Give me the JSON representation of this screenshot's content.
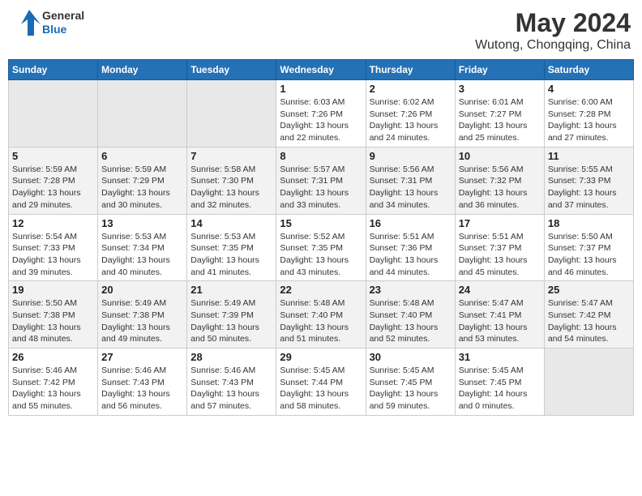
{
  "header": {
    "logo_line1": "General",
    "logo_line2": "Blue",
    "month_title": "May 2024",
    "location": "Wutong, Chongqing, China"
  },
  "weekdays": [
    "Sunday",
    "Monday",
    "Tuesday",
    "Wednesday",
    "Thursday",
    "Friday",
    "Saturday"
  ],
  "weeks": [
    [
      {
        "day": "",
        "info": ""
      },
      {
        "day": "",
        "info": ""
      },
      {
        "day": "",
        "info": ""
      },
      {
        "day": "1",
        "info": "Sunrise: 6:03 AM\nSunset: 7:26 PM\nDaylight: 13 hours\nand 22 minutes."
      },
      {
        "day": "2",
        "info": "Sunrise: 6:02 AM\nSunset: 7:26 PM\nDaylight: 13 hours\nand 24 minutes."
      },
      {
        "day": "3",
        "info": "Sunrise: 6:01 AM\nSunset: 7:27 PM\nDaylight: 13 hours\nand 25 minutes."
      },
      {
        "day": "4",
        "info": "Sunrise: 6:00 AM\nSunset: 7:28 PM\nDaylight: 13 hours\nand 27 minutes."
      }
    ],
    [
      {
        "day": "5",
        "info": "Sunrise: 5:59 AM\nSunset: 7:28 PM\nDaylight: 13 hours\nand 29 minutes."
      },
      {
        "day": "6",
        "info": "Sunrise: 5:59 AM\nSunset: 7:29 PM\nDaylight: 13 hours\nand 30 minutes."
      },
      {
        "day": "7",
        "info": "Sunrise: 5:58 AM\nSunset: 7:30 PM\nDaylight: 13 hours\nand 32 minutes."
      },
      {
        "day": "8",
        "info": "Sunrise: 5:57 AM\nSunset: 7:31 PM\nDaylight: 13 hours\nand 33 minutes."
      },
      {
        "day": "9",
        "info": "Sunrise: 5:56 AM\nSunset: 7:31 PM\nDaylight: 13 hours\nand 34 minutes."
      },
      {
        "day": "10",
        "info": "Sunrise: 5:56 AM\nSunset: 7:32 PM\nDaylight: 13 hours\nand 36 minutes."
      },
      {
        "day": "11",
        "info": "Sunrise: 5:55 AM\nSunset: 7:33 PM\nDaylight: 13 hours\nand 37 minutes."
      }
    ],
    [
      {
        "day": "12",
        "info": "Sunrise: 5:54 AM\nSunset: 7:33 PM\nDaylight: 13 hours\nand 39 minutes."
      },
      {
        "day": "13",
        "info": "Sunrise: 5:53 AM\nSunset: 7:34 PM\nDaylight: 13 hours\nand 40 minutes."
      },
      {
        "day": "14",
        "info": "Sunrise: 5:53 AM\nSunset: 7:35 PM\nDaylight: 13 hours\nand 41 minutes."
      },
      {
        "day": "15",
        "info": "Sunrise: 5:52 AM\nSunset: 7:35 PM\nDaylight: 13 hours\nand 43 minutes."
      },
      {
        "day": "16",
        "info": "Sunrise: 5:51 AM\nSunset: 7:36 PM\nDaylight: 13 hours\nand 44 minutes."
      },
      {
        "day": "17",
        "info": "Sunrise: 5:51 AM\nSunset: 7:37 PM\nDaylight: 13 hours\nand 45 minutes."
      },
      {
        "day": "18",
        "info": "Sunrise: 5:50 AM\nSunset: 7:37 PM\nDaylight: 13 hours\nand 46 minutes."
      }
    ],
    [
      {
        "day": "19",
        "info": "Sunrise: 5:50 AM\nSunset: 7:38 PM\nDaylight: 13 hours\nand 48 minutes."
      },
      {
        "day": "20",
        "info": "Sunrise: 5:49 AM\nSunset: 7:38 PM\nDaylight: 13 hours\nand 49 minutes."
      },
      {
        "day": "21",
        "info": "Sunrise: 5:49 AM\nSunset: 7:39 PM\nDaylight: 13 hours\nand 50 minutes."
      },
      {
        "day": "22",
        "info": "Sunrise: 5:48 AM\nSunset: 7:40 PM\nDaylight: 13 hours\nand 51 minutes."
      },
      {
        "day": "23",
        "info": "Sunrise: 5:48 AM\nSunset: 7:40 PM\nDaylight: 13 hours\nand 52 minutes."
      },
      {
        "day": "24",
        "info": "Sunrise: 5:47 AM\nSunset: 7:41 PM\nDaylight: 13 hours\nand 53 minutes."
      },
      {
        "day": "25",
        "info": "Sunrise: 5:47 AM\nSunset: 7:42 PM\nDaylight: 13 hours\nand 54 minutes."
      }
    ],
    [
      {
        "day": "26",
        "info": "Sunrise: 5:46 AM\nSunset: 7:42 PM\nDaylight: 13 hours\nand 55 minutes."
      },
      {
        "day": "27",
        "info": "Sunrise: 5:46 AM\nSunset: 7:43 PM\nDaylight: 13 hours\nand 56 minutes."
      },
      {
        "day": "28",
        "info": "Sunrise: 5:46 AM\nSunset: 7:43 PM\nDaylight: 13 hours\nand 57 minutes."
      },
      {
        "day": "29",
        "info": "Sunrise: 5:45 AM\nSunset: 7:44 PM\nDaylight: 13 hours\nand 58 minutes."
      },
      {
        "day": "30",
        "info": "Sunrise: 5:45 AM\nSunset: 7:45 PM\nDaylight: 13 hours\nand 59 minutes."
      },
      {
        "day": "31",
        "info": "Sunrise: 5:45 AM\nSunset: 7:45 PM\nDaylight: 14 hours\nand 0 minutes."
      },
      {
        "day": "",
        "info": ""
      }
    ]
  ]
}
